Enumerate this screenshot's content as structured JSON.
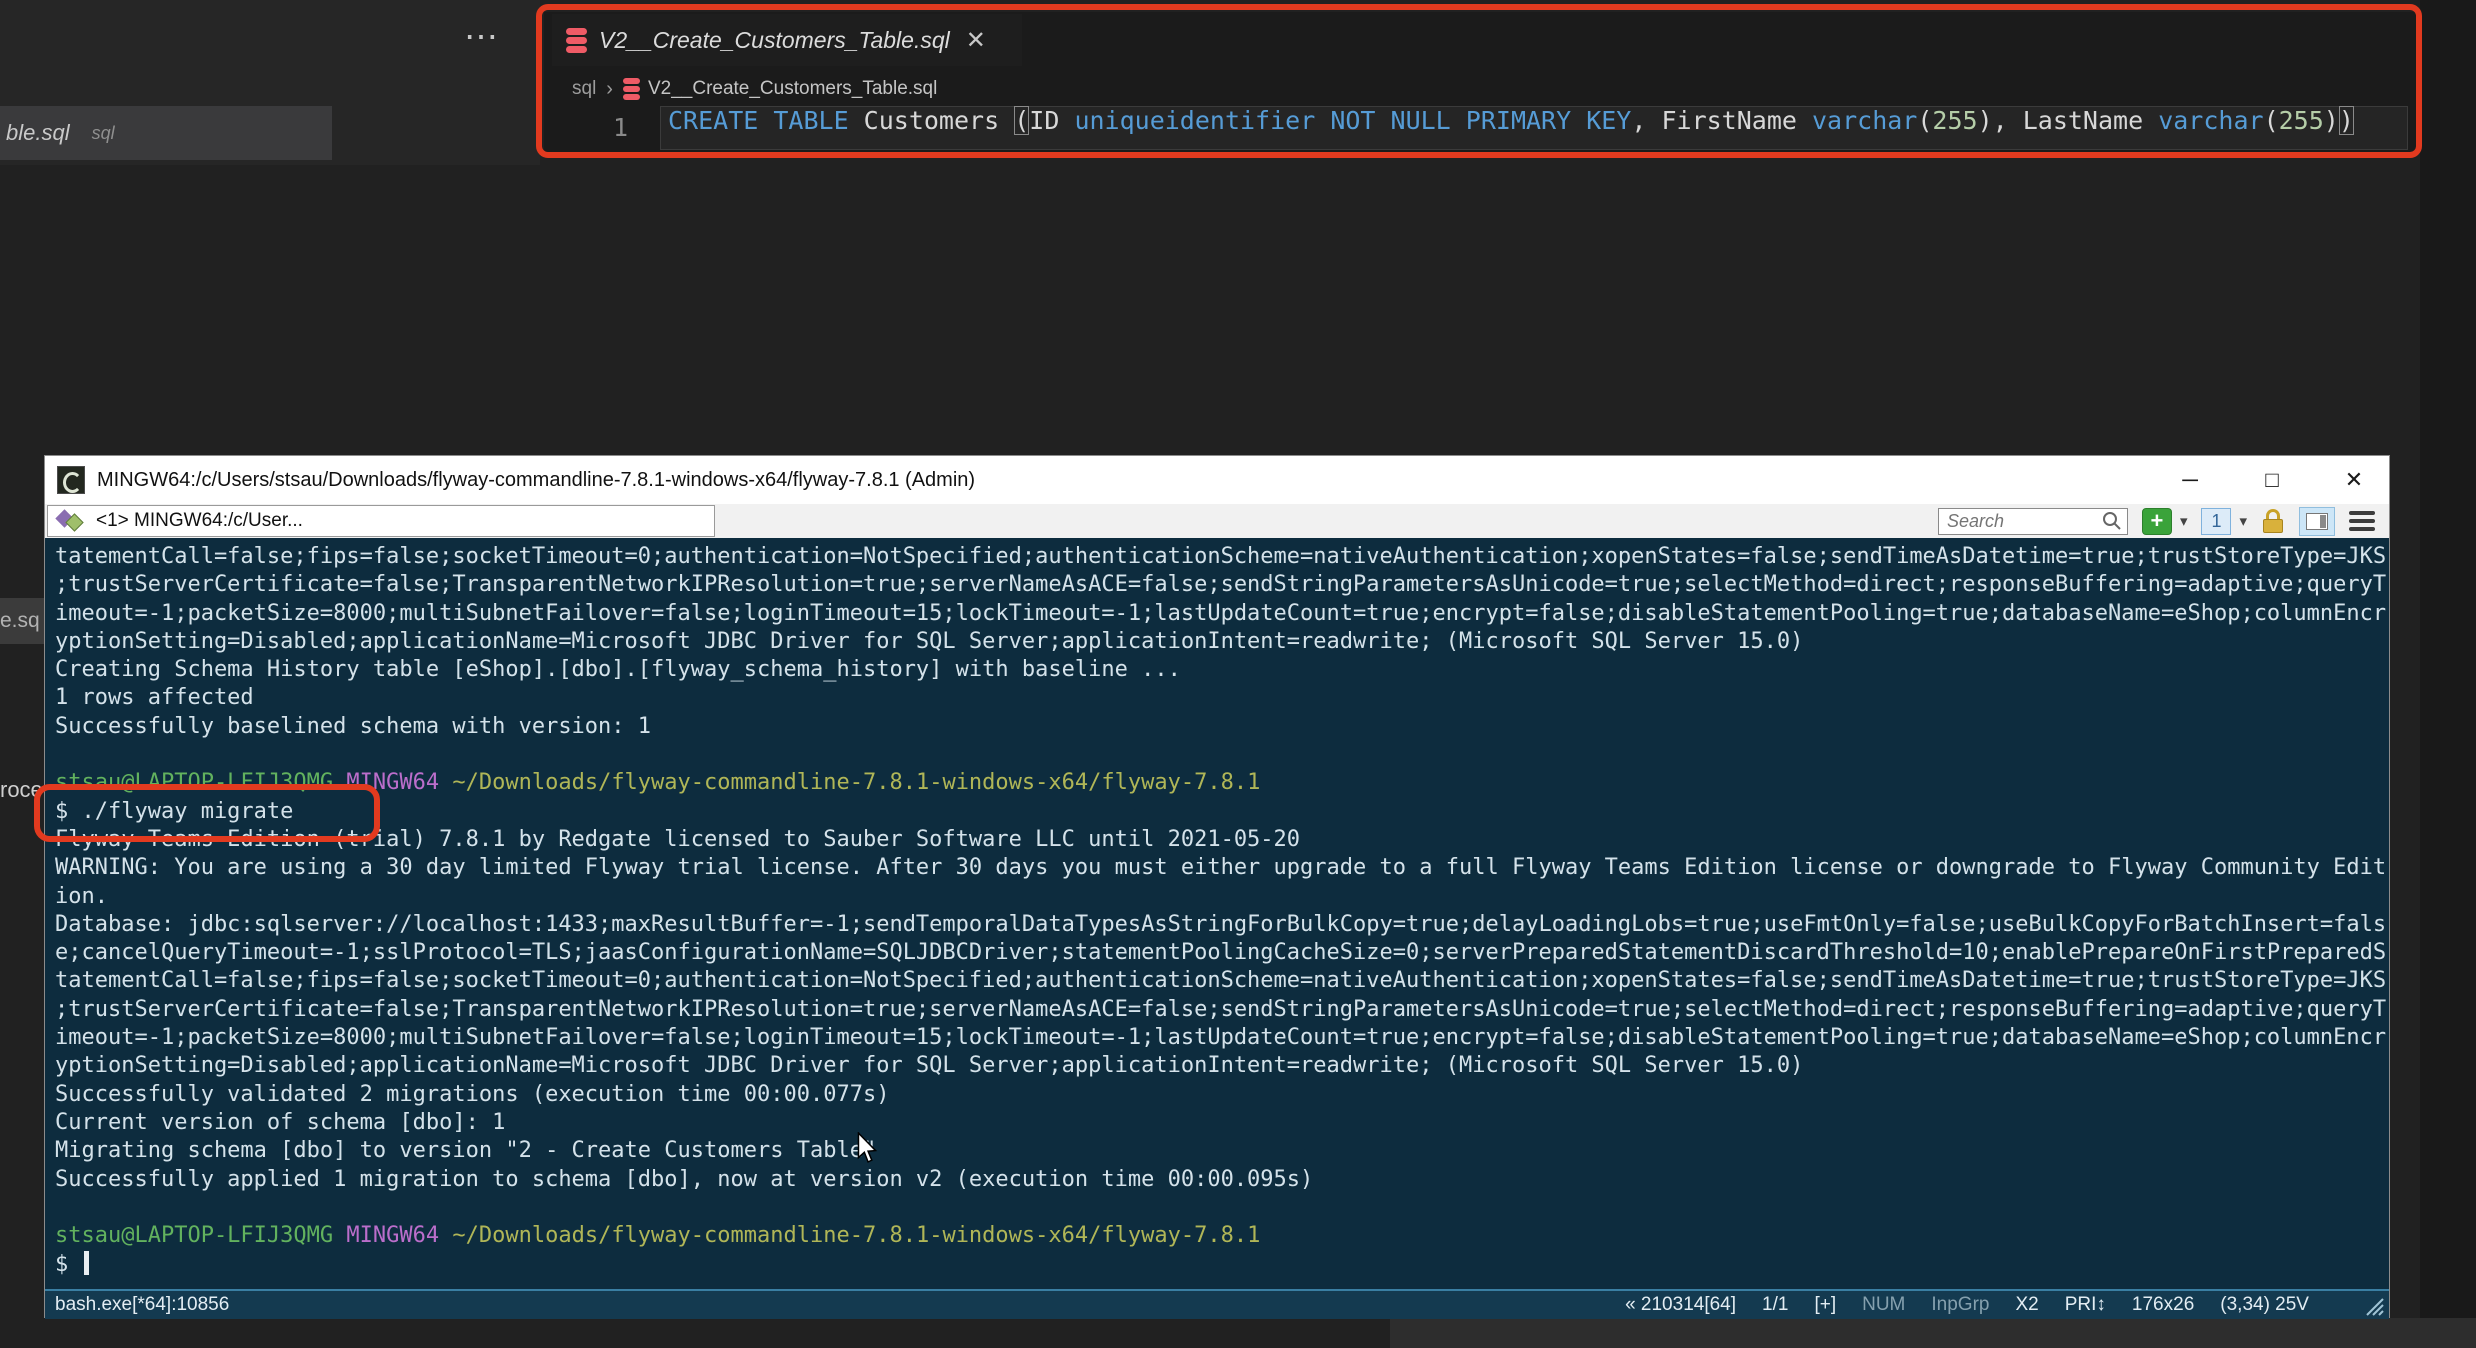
{
  "colors": {
    "annotation_red": "#e23a1f",
    "terminal_bg": "#0d2c3e",
    "terminal_text": "#d4e2ea",
    "prompt_user_green": "#62b25e",
    "prompt_msystem_magenta": "#bb6ecb",
    "prompt_path_yellow": "#b0b657",
    "keyword_blue": "#569cd6",
    "status_bar_bg": "#143a50",
    "db_icon_red": "#ef5b66"
  },
  "background": {
    "editor_chip": {
      "name": "ble.sql",
      "lang": "sql"
    },
    "fragment_mid": "e.sq",
    "fragment_low": "roce",
    "more_actions": "⋯"
  },
  "editor": {
    "tab": {
      "filename": "V2__Create_Customers_Table.sql",
      "close_glyph": "✕",
      "icon": "database-icon"
    },
    "breadcrumb": {
      "folder": "sql",
      "separator": "›",
      "filename": "V2__Create_Customers_Table.sql",
      "icon": "database-icon"
    },
    "code": {
      "line_number": "1",
      "tokens": [
        {
          "t": "CREATE TABLE",
          "c": "kw"
        },
        {
          "t": " Customers ",
          "c": "pl"
        },
        {
          "t": "(",
          "c": "brm"
        },
        {
          "t": "ID",
          "c": "pl"
        },
        {
          "t": " ",
          "c": "pl"
        },
        {
          "t": "uniqueidentifier",
          "c": "kw"
        },
        {
          "t": " ",
          "c": "pl"
        },
        {
          "t": "NOT NULL PRIMARY KEY",
          "c": "kw"
        },
        {
          "t": ", FirstName ",
          "c": "pl"
        },
        {
          "t": "varchar",
          "c": "kw"
        },
        {
          "t": "(",
          "c": "pl"
        },
        {
          "t": "255",
          "c": "num"
        },
        {
          "t": ")",
          "c": "pl"
        },
        {
          "t": ", LastName ",
          "c": "pl"
        },
        {
          "t": "varchar",
          "c": "kw"
        },
        {
          "t": "(",
          "c": "pl"
        },
        {
          "t": "255",
          "c": "num"
        },
        {
          "t": ")",
          "c": "pl"
        },
        {
          "t": ")",
          "c": "brm"
        }
      ]
    }
  },
  "terminal": {
    "title": "MINGW64:/c/Users/stsau/Downloads/flyway-commandline-7.8.1-windows-x64/flyway-7.8.1 (Admin)",
    "window_buttons": {
      "minimize": "─",
      "maximize": "□",
      "close": "✕"
    },
    "tab_label": "<1> MINGW64:/c/User...",
    "toolbar": {
      "search_placeholder": "Search",
      "new_tab_label": "+",
      "window_number": "1",
      "caret_glyph": "▾"
    },
    "lines": [
      {
        "t": "tatementCall=false;fips=false;socketTimeout=0;authentication=NotSpecified;authenticationScheme=nativeAuthentication;xopenStates=false;sendTimeAsDatetime=true;trustStoreType=JKS"
      },
      {
        "t": ";trustServerCertificate=false;TransparentNetworkIPResolution=true;serverNameAsACE=false;sendStringParametersAsUnicode=true;selectMethod=direct;responseBuffering=adaptive;queryT"
      },
      {
        "t": "imeout=-1;packetSize=8000;multiSubnetFailover=false;loginTimeout=15;lockTimeout=-1;lastUpdateCount=true;encrypt=false;disableStatementPooling=true;databaseName=eShop;columnEncr"
      },
      {
        "t": "yptionSetting=Disabled;applicationName=Microsoft JDBC Driver for SQL Server;applicationIntent=readwrite; (Microsoft SQL Server 15.0)"
      },
      {
        "t": "Creating Schema History table [eShop].[dbo].[flyway_schema_history] with baseline ..."
      },
      {
        "t": "1 rows affected"
      },
      {
        "t": "Successfully baselined schema with version: 1"
      },
      {
        "t": ""
      },
      {
        "s": [
          {
            "t": "stsau@LAPTOP-LFIJ3QMG ",
            "c": "g"
          },
          {
            "t": "MINGW64 ",
            "c": "m"
          },
          {
            "t": "~/Downloads/flyway-commandline-7.8.1-windows-x64/flyway-7.8.1",
            "c": "y"
          }
        ]
      },
      {
        "t": "$ ./flyway migrate"
      },
      {
        "t": "Flyway Teams Edition (trial) 7.8.1 by Redgate licensed to Sauber Software LLC until 2021-05-20"
      },
      {
        "t": "WARNING: You are using a 30 day limited Flyway trial license. After 30 days you must either upgrade to a full Flyway Teams Edition license or downgrade to Flyway Community Edit"
      },
      {
        "t": "ion."
      },
      {
        "t": "Database: jdbc:sqlserver://localhost:1433;maxResultBuffer=-1;sendTemporalDataTypesAsStringForBulkCopy=true;delayLoadingLobs=true;useFmtOnly=false;useBulkCopyForBatchInsert=fals"
      },
      {
        "t": "e;cancelQueryTimeout=-1;sslProtocol=TLS;jaasConfigurationName=SQLJDBCDriver;statementPoolingCacheSize=0;serverPreparedStatementDiscardThreshold=10;enablePrepareOnFirstPreparedS"
      },
      {
        "t": "tatementCall=false;fips=false;socketTimeout=0;authentication=NotSpecified;authenticationScheme=nativeAuthentication;xopenStates=false;sendTimeAsDatetime=true;trustStoreType=JKS"
      },
      {
        "t": ";trustServerCertificate=false;TransparentNetworkIPResolution=true;serverNameAsACE=false;sendStringParametersAsUnicode=true;selectMethod=direct;responseBuffering=adaptive;queryT"
      },
      {
        "t": "imeout=-1;packetSize=8000;multiSubnetFailover=false;loginTimeout=15;lockTimeout=-1;lastUpdateCount=true;encrypt=false;disableStatementPooling=true;databaseName=eShop;columnEncr"
      },
      {
        "t": "yptionSetting=Disabled;applicationName=Microsoft JDBC Driver for SQL Server;applicationIntent=readwrite; (Microsoft SQL Server 15.0)"
      },
      {
        "t": "Successfully validated 2 migrations (execution time 00:00.077s)"
      },
      {
        "t": "Current version of schema [dbo]: 1"
      },
      {
        "t": "Migrating schema [dbo] to version \"2 - Create Customers Table\""
      },
      {
        "t": "Successfully applied 1 migration to schema [dbo], now at version v2 (execution time 00:00.095s)"
      },
      {
        "t": ""
      },
      {
        "s": [
          {
            "t": "stsau@LAPTOP-LFIJ3QMG ",
            "c": "g"
          },
          {
            "t": "MINGW64 ",
            "c": "m"
          },
          {
            "t": "~/Downloads/flyway-commandline-7.8.1-windows-x64/flyway-7.8.1",
            "c": "y"
          }
        ]
      },
      {
        "t": "$ ",
        "cursor": true
      }
    ],
    "status": {
      "left": "bash.exe[*64]:10856",
      "right": [
        {
          "t": "« 210314[64]"
        },
        {
          "t": "1/1"
        },
        {
          "t": "[+]"
        },
        {
          "t": "NUM",
          "dim": true
        },
        {
          "t": "InpGrp",
          "dim": true
        },
        {
          "t": "X2"
        },
        {
          "t": "PRI↕"
        },
        {
          "t": "176x26"
        },
        {
          "t": "(3,34) 25V"
        }
      ]
    }
  }
}
